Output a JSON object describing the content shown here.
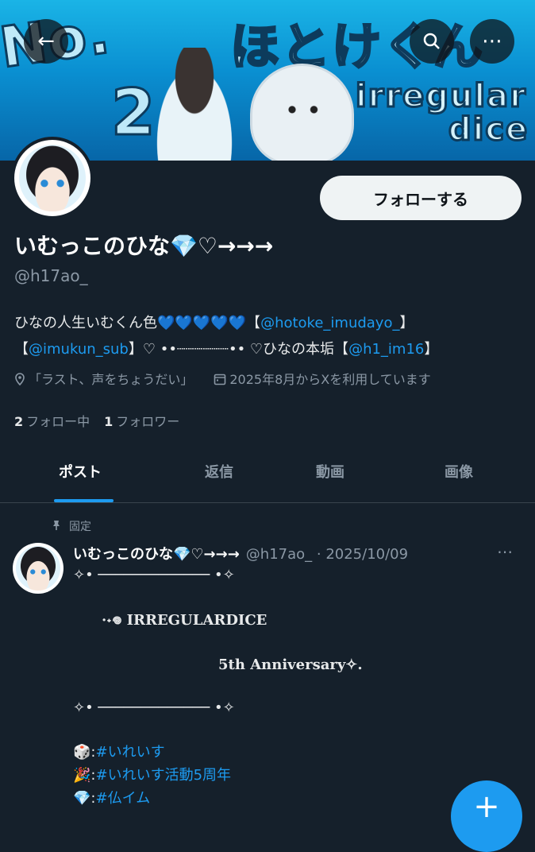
{
  "banner": {
    "text_no": "No.",
    "text_2": "2",
    "text_hotoke": "ほとけくん",
    "text_irregular": "irregular",
    "text_dice": "dice"
  },
  "header_icons": {
    "back": "←",
    "search": "⌕",
    "more": "⋯"
  },
  "profile": {
    "follow_label": "フォローする",
    "display_name": "いむっこのひな💎♡→→→",
    "handle": "@h17ao_",
    "bio_line1_pre": "ひなの人生いむくん色💙💙💙💙💙【",
    "bio_link1": "@hotoke_imudayo_",
    "bio_line1_post": "】",
    "bio_line2_pre": "【",
    "bio_link2": "@imukun_sub",
    "bio_line2_mid": "】♡ ••┈┈┈┈┈┈•• ♡ひなの本垢【",
    "bio_link3": "@h1_im16",
    "bio_line2_post": "】",
    "location": "「ラスト、声をちょうだい」",
    "joined": "2025年8月からXを利用しています",
    "following_count": "2",
    "following_label": "フォロー中",
    "followers_count": "1",
    "followers_label": "フォロワー"
  },
  "tabs": [
    "ポスト",
    "返信",
    "動画",
    "画像"
  ],
  "post": {
    "pinned_label": "固定",
    "author_name": "いむっこのひな💎♡→→→",
    "author_meta": "@h17ao_ · 2025/10/09",
    "line1": "✧• ───────────── •✧",
    "line2": "·˖𖦹 IRREGULARDICE",
    "line3": "5th Anniversary✧.",
    "line4": "✧• ───────────── •✧",
    "hashtag1_emoji": "🎲:",
    "hashtag1": "#いれいす",
    "hashtag2_emoji": "🎉:",
    "hashtag2": "#いれいす活動5周年",
    "hashtag3_emoji": "💎:",
    "hashtag3": "#仏イム"
  },
  "fab_label": "+",
  "colors": {
    "background": "#15202b",
    "accent": "#1d9bf0",
    "secondary_text": "#8b98a5"
  }
}
